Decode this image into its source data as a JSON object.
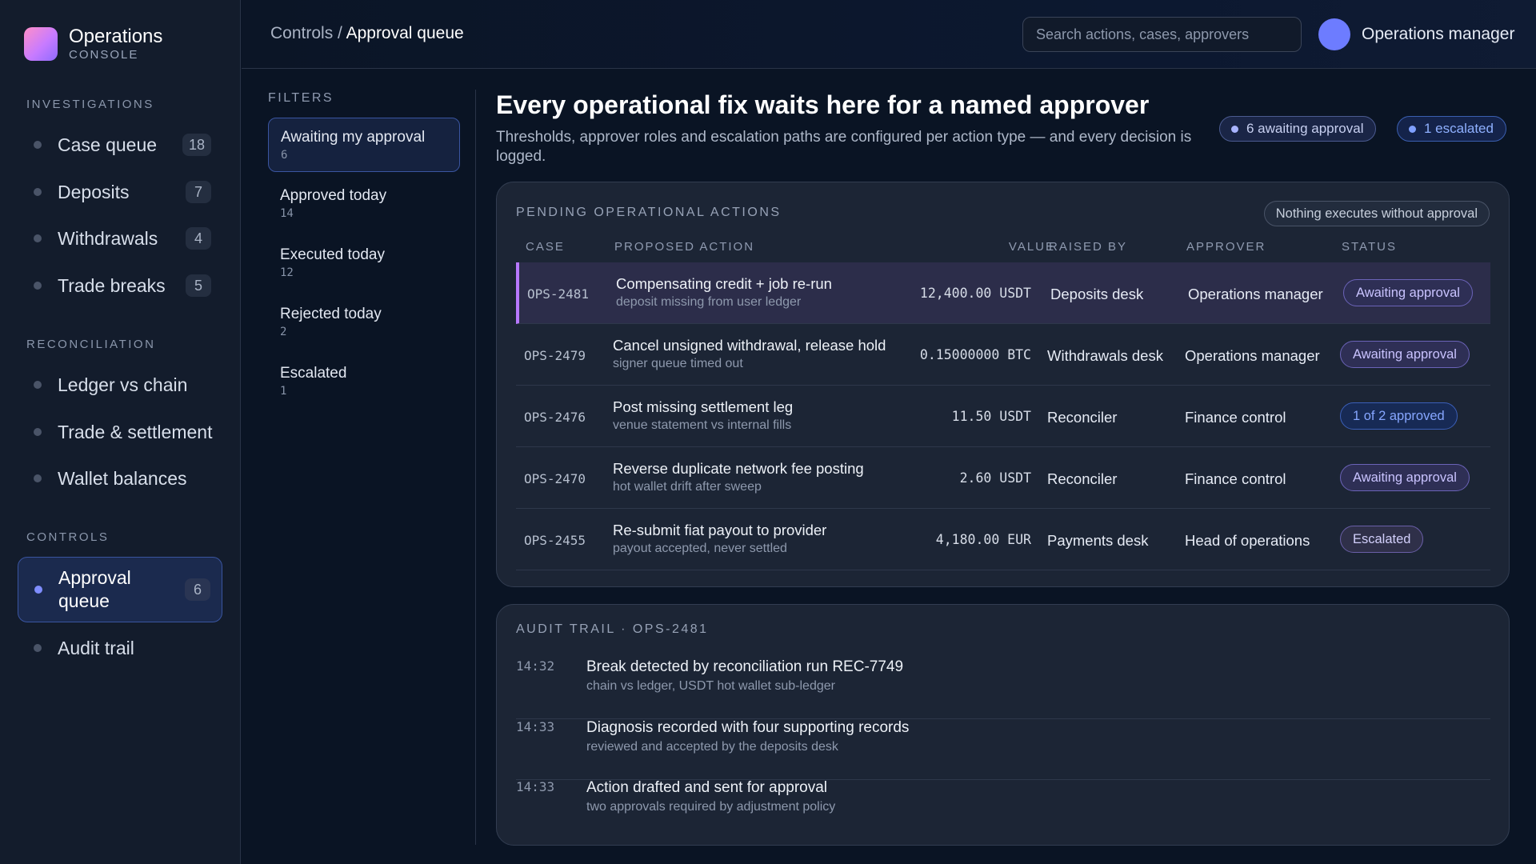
{
  "brand": {
    "title": "Operations",
    "subtitle": "CONSOLE"
  },
  "sidebar": {
    "sections": [
      {
        "title": "INVESTIGATIONS",
        "items": [
          {
            "label": "Case queue",
            "badge": "18"
          },
          {
            "label": "Deposits",
            "badge": "7"
          },
          {
            "label": "Withdrawals",
            "badge": "4"
          },
          {
            "label": "Trade breaks",
            "badge": "5"
          }
        ]
      },
      {
        "title": "RECONCILIATION",
        "items": [
          {
            "label": "Ledger vs chain"
          },
          {
            "label": "Trade & settlement"
          },
          {
            "label": "Wallet balances"
          }
        ]
      },
      {
        "title": "CONTROLS",
        "items": [
          {
            "label": "Approval queue",
            "badge": "6",
            "active": true
          },
          {
            "label": "Audit trail"
          }
        ]
      }
    ]
  },
  "topbar": {
    "breadcrumb_parent": "Controls",
    "breadcrumb_sep": "/",
    "breadcrumb_current": "Approval queue",
    "search_placeholder": "Search actions, cases, approvers",
    "user_name": "Operations manager"
  },
  "filters": {
    "title": "FILTERS",
    "items": [
      {
        "label": "Awaiting my approval",
        "count": "6",
        "active": true
      },
      {
        "label": "Approved today",
        "count": "14"
      },
      {
        "label": "Executed today",
        "count": "12"
      },
      {
        "label": "Rejected today",
        "count": "2"
      },
      {
        "label": "Escalated",
        "count": "1"
      }
    ]
  },
  "main": {
    "headline": "Every operational fix waits here for a named approver",
    "subline": "Thresholds, approver roles and escalation paths are configured per action type — and every decision is logged.",
    "pill_awaiting": "6 awaiting approval",
    "pill_escalated": "1 escalated"
  },
  "pending": {
    "title": "PENDING OPERATIONAL ACTIONS",
    "tag": "Nothing executes without approval",
    "columns": {
      "case": "CASE",
      "action": "PROPOSED ACTION",
      "value": "VALUE",
      "raised": "RAISED BY",
      "approver": "APPROVER",
      "status": "STATUS"
    },
    "rows": [
      {
        "case": "OPS-2481",
        "title": "Compensating credit + job re-run",
        "sub": "deposit missing from user ledger",
        "value": "12,400.00 USDT",
        "raised": "Deposits desk",
        "approver": "Operations manager",
        "status": "Awaiting approval",
        "status_kind": "awaiting"
      },
      {
        "case": "OPS-2479",
        "title": "Cancel unsigned withdrawal, release hold",
        "sub": "signer queue timed out",
        "value": "0.15000000 BTC",
        "raised": "Withdrawals desk",
        "approver": "Operations manager",
        "status": "Awaiting approval",
        "status_kind": "awaiting"
      },
      {
        "case": "OPS-2476",
        "title": "Post missing settlement leg",
        "sub": "venue statement vs internal fills",
        "value": "11.50 USDT",
        "raised": "Reconciler",
        "approver": "Finance control",
        "status": "1 of 2 approved",
        "status_kind": "partial"
      },
      {
        "case": "OPS-2470",
        "title": "Reverse duplicate network fee posting",
        "sub": "hot wallet drift after sweep",
        "value": "2.60 USDT",
        "raised": "Reconciler",
        "approver": "Finance control",
        "status": "Awaiting approval",
        "status_kind": "awaiting"
      },
      {
        "case": "OPS-2455",
        "title": "Re-submit fiat payout to provider",
        "sub": "payout accepted, never settled",
        "value": "4,180.00 EUR",
        "raised": "Payments desk",
        "approver": "Head of operations",
        "status": "Escalated",
        "status_kind": "escalated"
      }
    ]
  },
  "audit": {
    "title": "AUDIT TRAIL · OPS-2481",
    "items": [
      {
        "time": "14:32",
        "title": "Break detected by reconciliation run REC-7749",
        "sub": "chain vs ledger, USDT hot wallet sub-ledger"
      },
      {
        "time": "14:33",
        "title": "Diagnosis recorded with four supporting records",
        "sub": "reviewed and accepted by the deposits desk"
      },
      {
        "time": "14:33",
        "title": "Action drafted and sent for approval",
        "sub": "two approvals required by adjustment policy"
      }
    ]
  },
  "colors": {
    "accent": "#7f8dff",
    "selected_row_bar": "#b778ff",
    "awaiting": "#c9c3ff",
    "partial": "#86a6ff"
  }
}
